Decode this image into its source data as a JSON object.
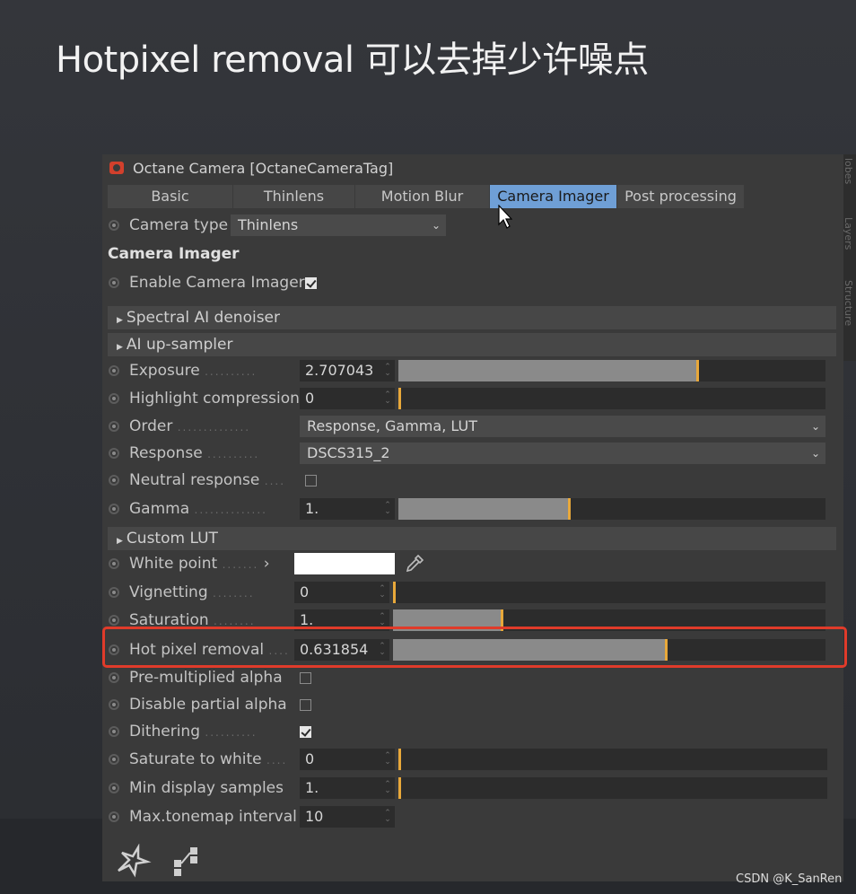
{
  "slide": {
    "title": "Hotpixel removal 可以去掉少许噪点"
  },
  "panel": {
    "title": "Octane Camera [OctaneCameraTag]",
    "tabs": [
      {
        "label": "Basic",
        "active": false
      },
      {
        "label": "Thinlens",
        "active": false
      },
      {
        "label": "Motion Blur",
        "active": false
      },
      {
        "label": "Camera Imager",
        "active": true
      },
      {
        "label": "Post processing",
        "active": false
      }
    ],
    "camera_type": {
      "label": "Camera type",
      "value": "Thinlens"
    },
    "group_title": "Camera Imager",
    "enable_imager": {
      "label": "Enable Camera Imager",
      "checked": true
    },
    "sections": {
      "spectral": "Spectral AI denoiser",
      "upsampler": "AI up-sampler",
      "custom_lut": "Custom LUT"
    },
    "exposure": {
      "label": "Exposure",
      "value": "2.707043",
      "level": 0.7
    },
    "highlight": {
      "label": "Highlight compression",
      "value": "0",
      "level": 0.0
    },
    "order": {
      "label": "Order",
      "value": "Response, Gamma, LUT"
    },
    "response": {
      "label": "Response",
      "value": "DSCS315_2"
    },
    "neutral": {
      "label": "Neutral response",
      "checked": false
    },
    "gamma": {
      "label": "Gamma",
      "value": "1.",
      "level": 0.4
    },
    "white_point": {
      "label": "White point",
      "color": "#ffffff"
    },
    "vignetting": {
      "label": "Vignetting",
      "value": "0",
      "level": 0.0
    },
    "saturation": {
      "label": "Saturation",
      "value": "1.",
      "level": 0.25
    },
    "hot_pixel": {
      "label": "Hot pixel removal",
      "value": "0.631854",
      "level": 0.63
    },
    "premult": {
      "label": "Pre-multiplied alpha",
      "checked": false
    },
    "partial": {
      "label": "Disable partial alpha",
      "checked": false
    },
    "dithering": {
      "label": "Dithering",
      "checked": true
    },
    "sat_white": {
      "label": "Saturate to white",
      "value": "0",
      "level": 0.0
    },
    "min_samples": {
      "label": "Min display samples",
      "value": "1.",
      "level": 0.0
    },
    "max_tonemap": {
      "label": "Max.tonemap interval",
      "value": "10"
    }
  },
  "side_tabs": [
    "lobes",
    "Layers",
    "Structure"
  ],
  "watermark": "CSDN @K_SanRen",
  "colors": {
    "accent": "#e8a83a",
    "highlight_border": "#e03b2a",
    "tab_active": "#6f9fd6"
  }
}
